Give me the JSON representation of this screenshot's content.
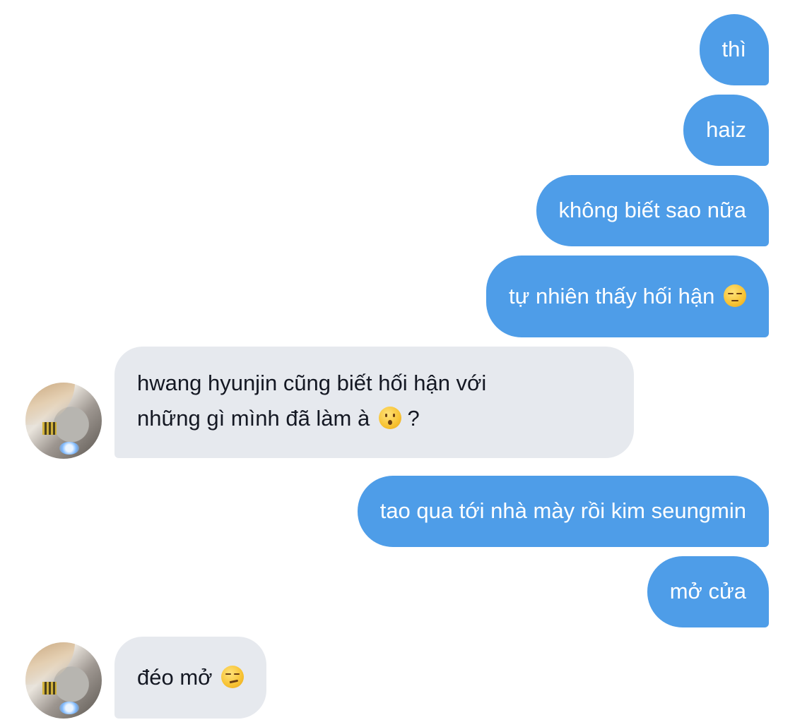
{
  "messages": [
    {
      "from": "me",
      "text": "thì"
    },
    {
      "from": "me",
      "text": "haiz"
    },
    {
      "from": "me",
      "text": "không biết sao nữa"
    },
    {
      "from": "me",
      "text": "tự nhiên thấy hối hận",
      "emoji": "pensive-face-emoji"
    },
    {
      "from": "other",
      "line1": "hwang hyunjin cũng biết hối hận với",
      "line2": "những gì mình đã làm à",
      "emoji": "hushed-face-emoji",
      "suffix": " ?"
    },
    {
      "from": "me",
      "text": "tao qua tới nhà mày rồi kim seungmin"
    },
    {
      "from": "me",
      "text": "mở cửa"
    },
    {
      "from": "other",
      "text": "đéo mở",
      "emoji": "smirking-face-emoji"
    }
  ],
  "colors": {
    "sent_bubble": "#4e9de8",
    "received_bubble": "#e6e9ee",
    "sent_text": "#ffffff",
    "received_text": "#141823"
  }
}
